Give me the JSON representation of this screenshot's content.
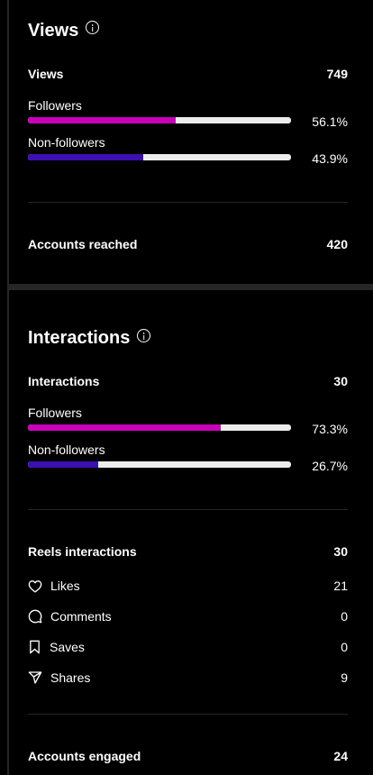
{
  "views": {
    "title": "Views",
    "total_label": "Views",
    "total_value": "749",
    "followers": {
      "label": "Followers",
      "percent": 56.1,
      "percent_text": "56.1%",
      "color": "#c800b8"
    },
    "non_followers": {
      "label": "Non-followers",
      "percent": 43.9,
      "percent_text": "43.9%",
      "color": "#3c10b0"
    },
    "reached_label": "Accounts reached",
    "reached_value": "420"
  },
  "interactions": {
    "title": "Interactions",
    "total_label": "Interactions",
    "total_value": "30",
    "followers": {
      "label": "Followers",
      "percent": 73.3,
      "percent_text": "73.3%",
      "color": "#c800b8"
    },
    "non_followers": {
      "label": "Non-followers",
      "percent": 26.7,
      "percent_text": "26.7%",
      "color": "#3c10b0"
    },
    "reels_label": "Reels interactions",
    "reels_value": "30",
    "breakdown": [
      {
        "label": "Likes",
        "value": "21",
        "icon": "heart-icon"
      },
      {
        "label": "Comments",
        "value": "0",
        "icon": "comment-icon"
      },
      {
        "label": "Saves",
        "value": "0",
        "icon": "bookmark-icon"
      },
      {
        "label": "Shares",
        "value": "9",
        "icon": "share-icon"
      }
    ],
    "engaged_label": "Accounts engaged",
    "engaged_value": "24"
  }
}
